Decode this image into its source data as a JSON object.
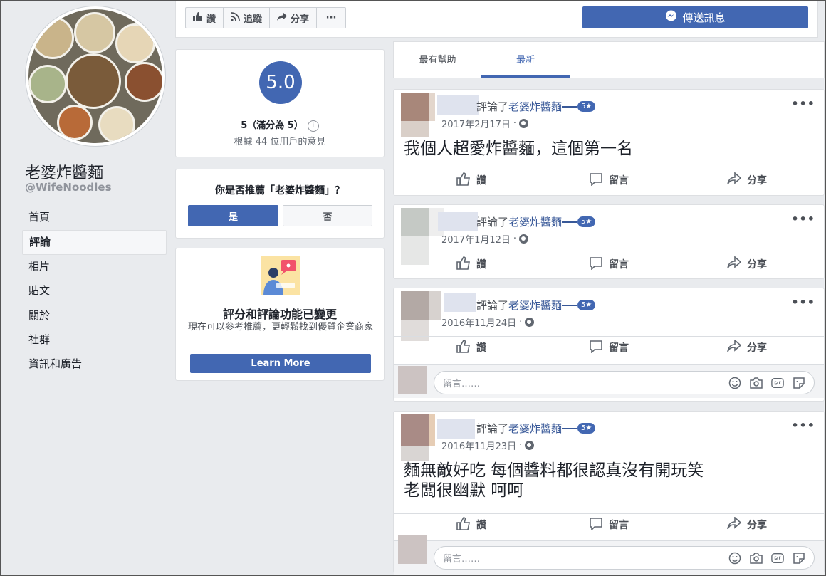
{
  "page": {
    "name": "老婆炸醬麵",
    "handle": "@WifeNoodles"
  },
  "nav": {
    "items": [
      {
        "label": "首頁"
      },
      {
        "label": "評論"
      },
      {
        "label": "相片"
      },
      {
        "label": "貼文"
      },
      {
        "label": "關於"
      },
      {
        "label": "社群"
      },
      {
        "label": "資訊和廣告"
      }
    ],
    "active": "評論"
  },
  "toolbar": {
    "like_label": "讚",
    "follow_label": "追蹤",
    "share_label": "分享",
    "more_label": "···",
    "message_label": "傳送訊息"
  },
  "rating": {
    "score": "5.0",
    "summary": "5（滿分為 5）",
    "info": "i",
    "based_on": "根據 44 位用戶的意見"
  },
  "recommend": {
    "question": "你是否推薦「老婆炸醬麵」？",
    "yes": "是",
    "no": "否"
  },
  "change_notice": {
    "title": "評分和評論功能已變更",
    "description": "現在可以參考推薦，更輕鬆找到優質企業商家",
    "button": "Learn More"
  },
  "tabs": {
    "helpful": "最有幫助",
    "newest": "最新",
    "active": "最新"
  },
  "review_common": {
    "reviewed_label": "評論了",
    "page_link": "老婆炸醬麵",
    "star_badge": "5★",
    "like": "讚",
    "comment": "留言",
    "share": "分享",
    "comment_placeholder": "留言……",
    "more": "•••"
  },
  "reviews": [
    {
      "date": "2017年2月17日",
      "text": "我個人超愛炸醬麵，這個第一名"
    },
    {
      "date": "2017年1月12日",
      "text": ""
    },
    {
      "date": "2016年11月24日",
      "text": ""
    },
    {
      "date": "2016年11月23日",
      "text": "麵無敵好吃 每個醬料都很認真沒有開玩笑\n老闆很幽默 呵呵"
    }
  ],
  "colors": {
    "brand_blue": "#4267b2",
    "link_blue": "#385898",
    "background": "#e9ebee"
  }
}
